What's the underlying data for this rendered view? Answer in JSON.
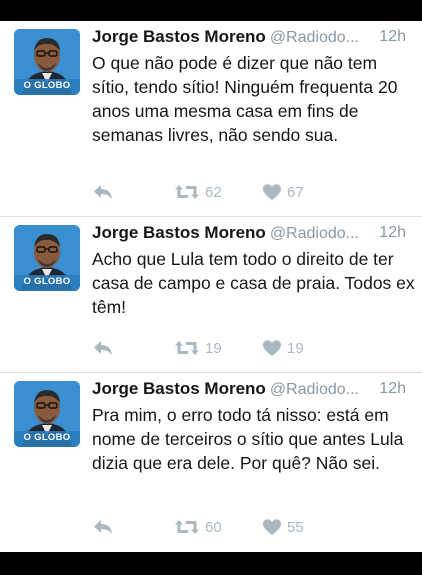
{
  "tweets": [
    {
      "author": "Jorge Bastos Moreno",
      "handle": "@Radiodo...",
      "time": "12h",
      "avatar_label": "O GLOBO",
      "text": "O que não pode é dizer que não tem sítio, tendo sítio! Ninguém frequenta 20 anos uma mesma casa em fins de semanas livres, não sendo sua.",
      "retweets": "62",
      "likes": "67"
    },
    {
      "author": "Jorge Bastos Moreno",
      "handle": "@Radiodo...",
      "time": "12h",
      "avatar_label": "O GLOBO",
      "text": "Acho que Lula tem todo o direito de ter casa de campo e casa de praia. Todos ex têm!",
      "retweets": "19",
      "likes": "19"
    },
    {
      "author": "Jorge Bastos Moreno",
      "handle": "@Radiodo...",
      "time": "12h",
      "avatar_label": "O GLOBO",
      "text": "Pra mim, o erro todo tá nisso: está em nome de terceiros o sítio que antes Lula dizia que era dele. Por quê? Não sei.",
      "retweets": "60",
      "likes": "55"
    }
  ],
  "icons": {
    "reply": "reply-icon",
    "retweet": "retweet-icon",
    "like": "heart-icon"
  },
  "colors": {
    "text": "#14171a",
    "muted": "#8899a6",
    "icon": "#aab8c2",
    "avatar_bg": "#2a7fc0"
  }
}
